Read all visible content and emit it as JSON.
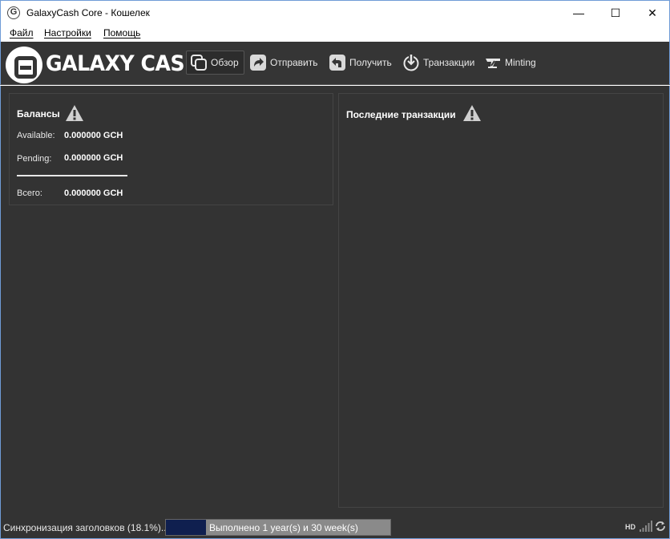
{
  "window": {
    "title": "GalaxyCash Core - Кошелек",
    "app_icon_letter": "G",
    "minimize": "—",
    "maximize": "☐",
    "close": "✕"
  },
  "menu": {
    "items": [
      {
        "label": "Файл"
      },
      {
        "label": "Настройки"
      },
      {
        "label": "Помощь"
      }
    ]
  },
  "toolbar": {
    "logo_text": "GALAXY CASH",
    "buttons": [
      {
        "label": "Обзор",
        "icon": "overview-icon",
        "active": true
      },
      {
        "label": "Отправить",
        "icon": "send-icon"
      },
      {
        "label": "Получить",
        "icon": "receive-icon"
      },
      {
        "label": "Транзакции",
        "icon": "transactions-icon"
      },
      {
        "label": "Minting",
        "icon": "minting-icon"
      }
    ]
  },
  "balances": {
    "title": "Балансы",
    "available_label": "Available:",
    "available_value": "0.000000 GCH",
    "pending_label": "Pending:",
    "pending_value": "0.000000 GCH",
    "total_label": "Всего:",
    "total_value": "0.000000 GCH"
  },
  "recent": {
    "title": "Последние транзакции"
  },
  "status": {
    "sync_text": "Синхронизация заголовков (18.1%)...",
    "progress_text": "Выполнено 1 year(s) и 30 week(s)",
    "progress_fraction": 0.18,
    "hd_label": "HD"
  },
  "colors": {
    "background": "#333333",
    "toolbar": "#353535",
    "progress_fill": "#0f1f4f",
    "text": "#ffffff"
  }
}
